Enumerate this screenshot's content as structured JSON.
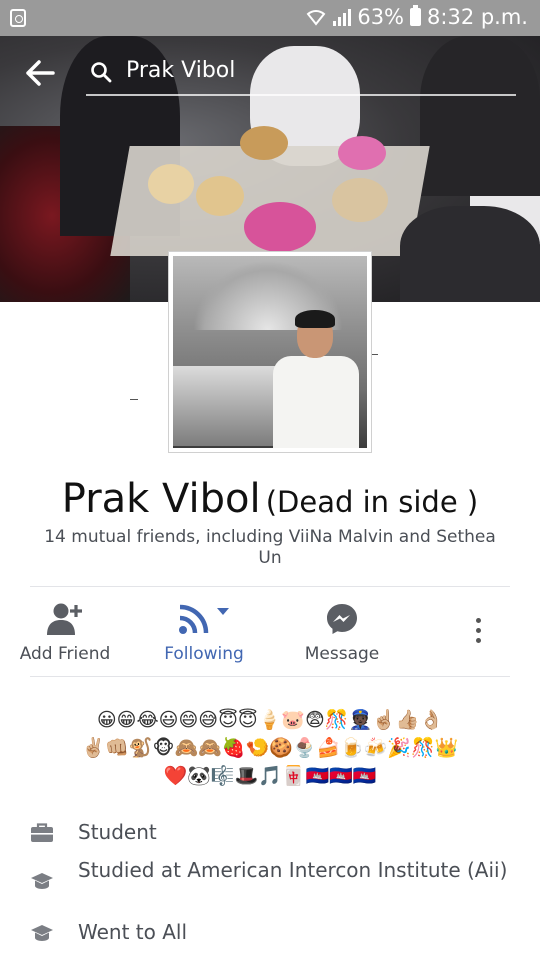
{
  "status_bar": {
    "battery": "63%",
    "time": "8:32 p.m."
  },
  "search": {
    "query": "Prak Vibol"
  },
  "profile": {
    "name": "Prak Vibol",
    "alt_name": "(Dead in side )",
    "mutual_friends": "14 mutual friends, including ViiNa Malvin and Sethea Un"
  },
  "actions": {
    "add_friend": "Add Friend",
    "following": "Following",
    "message": "Message"
  },
  "bio_emoji": [
    "😀😁😂😃😄😅😇😇🍦🐷😨🎊👮🏿☝🏼👍🏼👌🏼",
    "✌🏼👊🏼🐒🐵🙈🙈🍓🍤🍪🍨🍰🍺🍻🎉🎊👑",
    "❤️🐼🎼🎩🎵🀄️🇰🇭🇰🇭🇰🇭"
  ],
  "info": [
    {
      "icon": "briefcase-icon",
      "text": "Student"
    },
    {
      "icon": "graduation-cap-icon",
      "text": "Studied at American Intercon Institute (Aii)"
    },
    {
      "icon": "graduation-cap-icon",
      "text": "Went to All"
    }
  ],
  "colors": {
    "accent": "#4267b2",
    "status_bar": "#9a9a9a",
    "text_secondary": "#4b4f56"
  }
}
